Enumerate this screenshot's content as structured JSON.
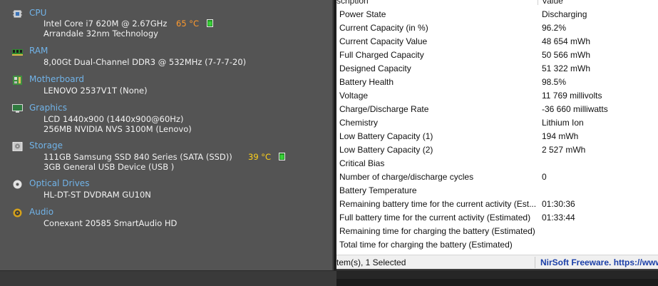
{
  "summary": {
    "cpu": {
      "icon": "cpu-chip-icon",
      "title": "CPU",
      "line1": "Intel Core i7 620M @ 2.67GHz",
      "line2": "Arrandale 32nm Technology",
      "temperature": "65 °C",
      "temp_color": "#ff9a2e"
    },
    "ram": {
      "icon": "ram-module-icon",
      "title": "RAM",
      "line1": "8,00Gt Dual-Channel DDR3 @ 532MHz (7-7-7-20)"
    },
    "motherboard": {
      "icon": "motherboard-icon",
      "title": "Motherboard",
      "line1": "LENOVO 2537V1T (None)"
    },
    "graphics": {
      "icon": "monitor-icon",
      "title": "Graphics",
      "line1": "LCD 1440x900 (1440x900@60Hz)",
      "line2": "256MB NVIDIA NVS 3100M (Lenovo)"
    },
    "storage": {
      "icon": "hard-drive-icon",
      "title": "Storage",
      "line1": "111GB Samsung SSD 840 Series (SATA (SSD))",
      "line2": "3GB General USB Device (USB )",
      "temperature": "39 °C",
      "temp_color": "#ffd21a"
    },
    "optical": {
      "icon": "optical-disc-icon",
      "title": "Optical Drives",
      "line1": "HL-DT-ST DVDRAM GU10N"
    },
    "audio": {
      "icon": "speaker-icon",
      "title": "Audio",
      "line1": "Conexant 20585 SmartAudio HD"
    }
  },
  "battery_list": {
    "header_property": "scription",
    "header_value": "Value",
    "rows": [
      {
        "property": "Power State",
        "value": "Discharging"
      },
      {
        "property": "Current Capacity (in %)",
        "value": "96.2%"
      },
      {
        "property": "Current Capacity Value",
        "value": "48 654 mWh"
      },
      {
        "property": "Full Charged Capacity",
        "value": "50 566 mWh"
      },
      {
        "property": "Designed Capacity",
        "value": "51 322 mWh"
      },
      {
        "property": "Battery Health",
        "value": "98.5%"
      },
      {
        "property": "Voltage",
        "value": "11 769 millivolts"
      },
      {
        "property": "Charge/Discharge Rate",
        "value": "-36 660 milliwatts"
      },
      {
        "property": "Chemistry",
        "value": "Lithium Ion"
      },
      {
        "property": "Low Battery Capacity (1)",
        "value": "194 mWh"
      },
      {
        "property": "Low Battery Capacity (2)",
        "value": "2 527 mWh"
      },
      {
        "property": "Critical Bias",
        "value": ""
      },
      {
        "property": "Number of charge/discharge cycles",
        "value": "0"
      },
      {
        "property": "Battery Temperature",
        "value": ""
      },
      {
        "property": "Remaining battery time for the current activity (Est...",
        "value": "01:30:36"
      },
      {
        "property": "Full battery time for the current activity (Estimated)",
        "value": "01:33:44"
      },
      {
        "property": "Remaining time for charging the battery (Estimated)",
        "value": ""
      },
      {
        "property": "Total  time for charging the battery (Estimated)",
        "value": ""
      }
    ]
  },
  "status_bar": {
    "items_text": "tem(s), 1 Selected",
    "credit_text": "NirSoft Freeware. https://www"
  }
}
